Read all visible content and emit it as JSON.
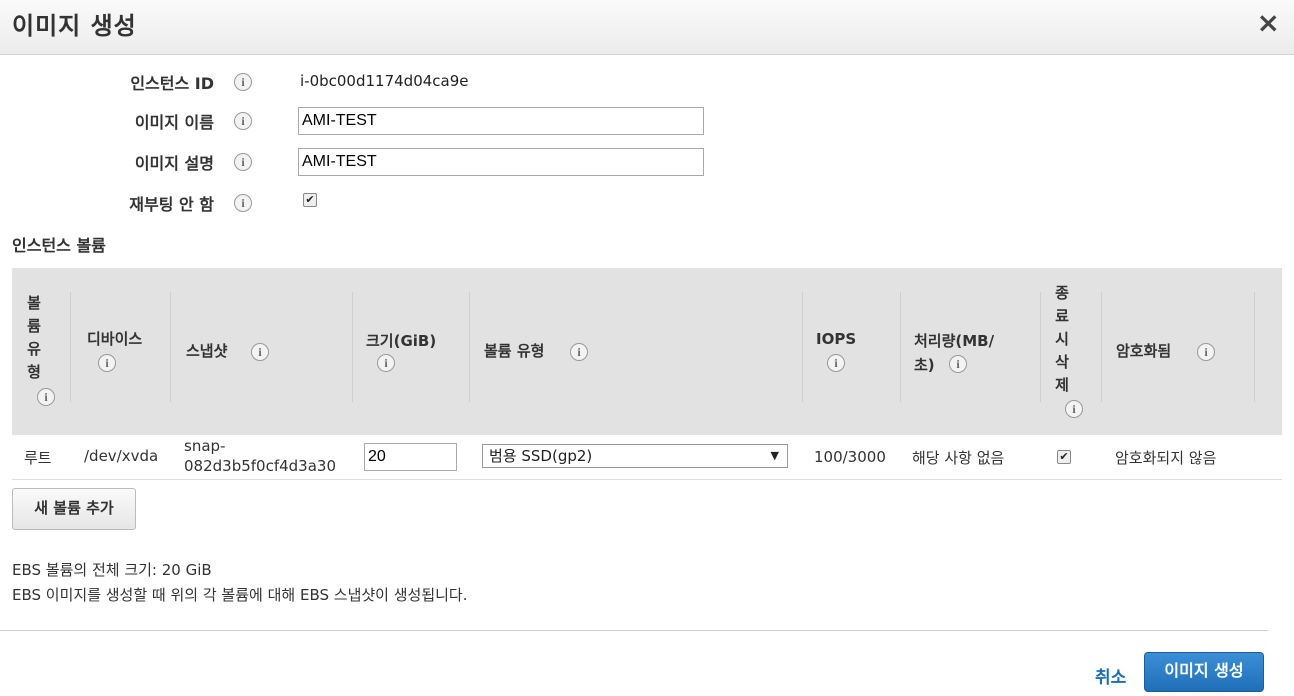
{
  "dialog": {
    "title": "이미지 생성",
    "close_icon": "×"
  },
  "form": {
    "instance_id_label": "인스턴스 ID",
    "instance_id_value": "i-0bc00d1174d04ca9e",
    "image_name_label": "이미지 이름",
    "image_name_value": "AMI-TEST",
    "image_desc_label": "이미지 설명",
    "image_desc_value": "AMI-TEST",
    "no_reboot_label": "재부팅 안 함",
    "no_reboot_checked": true
  },
  "volumes": {
    "section_title": "인스턴스 볼륨",
    "columns": {
      "volume_type_stacked": [
        "볼",
        "륨",
        "유",
        "형"
      ],
      "device": "디바이스",
      "snapshot": "스냅샷",
      "size": "크기(GiB)",
      "vol_type": "볼륨 유형",
      "iops": "IOPS",
      "throughput_line1": "처리량(MB/",
      "throughput_line2": "초)",
      "delete_on_term_stacked": [
        "종",
        "료",
        "시",
        "삭",
        "제"
      ],
      "encrypted": "암호화됨"
    },
    "rows": [
      {
        "type": "루트",
        "device": "/dev/xvda",
        "snapshot_line1": "snap-",
        "snapshot_line2": "082d3b5f0cf4d3a30",
        "size": "20",
        "vol_type": "범용 SSD(gp2)",
        "iops": "100/3000",
        "throughput": "해당 사항 없음",
        "delete_on_term": true,
        "encrypted": "암호화되지 않음"
      }
    ],
    "add_button": "새 볼륨 추가"
  },
  "notes": {
    "total": "EBS 볼륨의 전체 크기: 20 GiB",
    "info": "EBS 이미지를 생성할 때 위의 각 볼륨에 대해 EBS 스냅샷이 생성됩니다."
  },
  "footer": {
    "cancel": "취소",
    "create": "이미지 생성"
  },
  "icons": {
    "info": "i",
    "check": "✔",
    "dropdown": "▼"
  }
}
